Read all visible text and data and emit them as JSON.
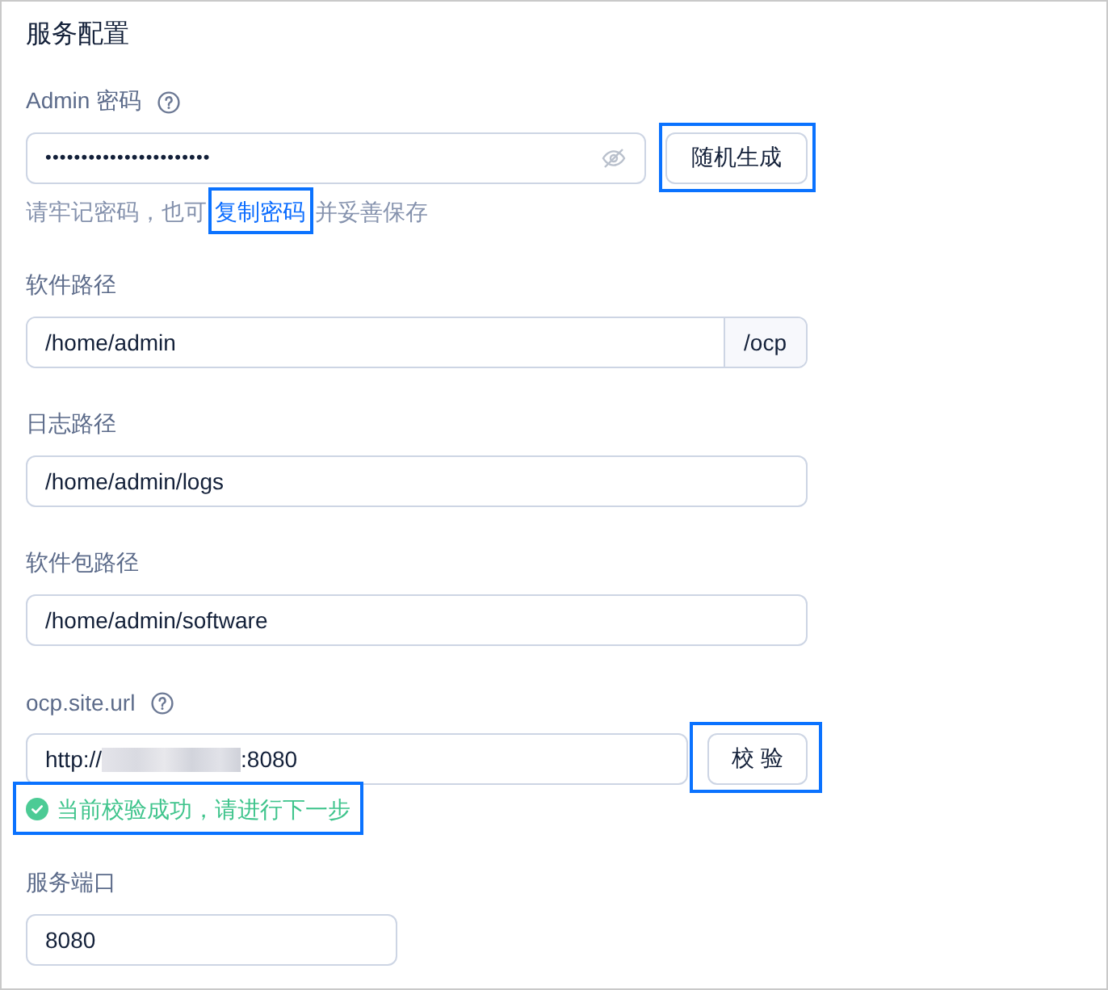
{
  "section": {
    "title": "服务配置"
  },
  "fields": [
    {
      "kind": "password",
      "label": "Admin 密码",
      "help_icon": true,
      "masked_value": "•••••••••••••••••••••••",
      "button": {
        "label": "随机生成",
        "highlighted": true
      },
      "hint": [
        {
          "kind": "text",
          "text": "请牢记密码，也可"
        },
        {
          "kind": "link",
          "text": "复制密码",
          "highlighted": true
        },
        {
          "kind": "text",
          "text": "并妥善保存"
        }
      ]
    },
    {
      "kind": "addon",
      "label": "软件路径",
      "help_icon": false,
      "value": "/home/admin",
      "addon": "/ocp"
    },
    {
      "kind": "text",
      "label": "日志路径",
      "help_icon": false,
      "value": "/home/admin/logs"
    },
    {
      "kind": "text",
      "label": "软件包路径",
      "help_icon": false,
      "value": "/home/admin/software"
    },
    {
      "kind": "url",
      "label": "ocp.site.url",
      "help_icon": true,
      "value_before": "http://",
      "redacted": true,
      "value_after": ":8080",
      "button": {
        "label": "校 验",
        "highlighted": true
      },
      "message": {
        "kind": "success",
        "text": "当前校验成功，请进行下一步",
        "highlighted": true
      }
    },
    {
      "kind": "short",
      "label": "服务端口",
      "help_icon": false,
      "value": "8080"
    }
  ]
}
